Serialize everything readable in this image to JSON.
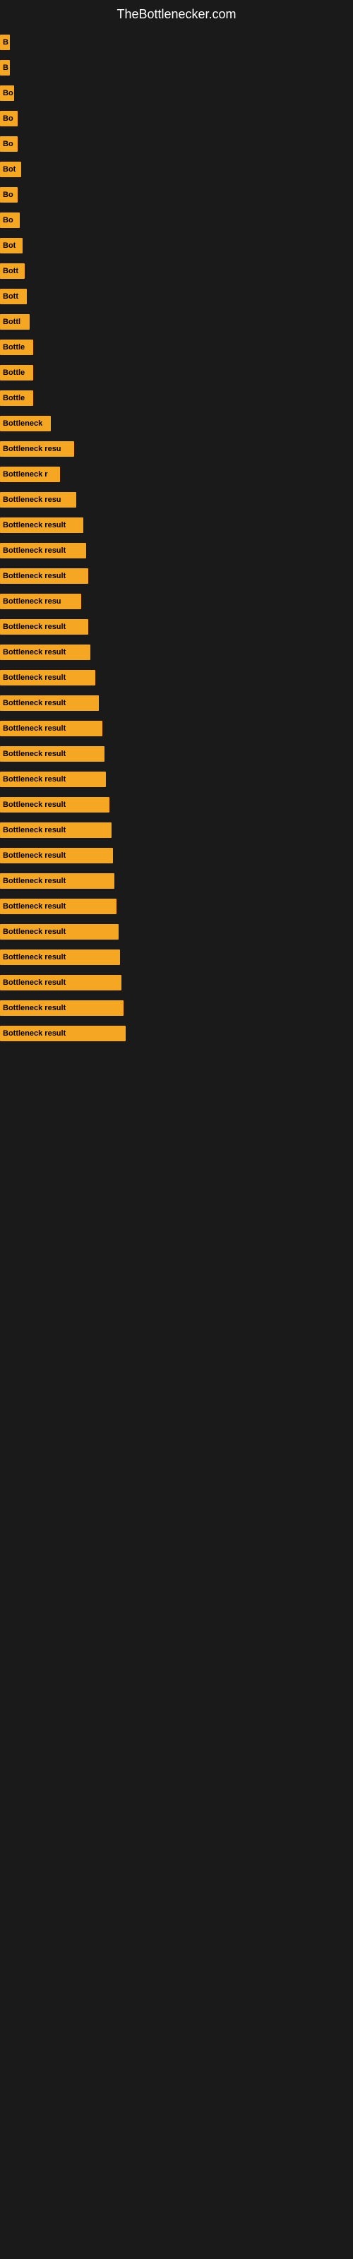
{
  "header": {
    "title": "TheBottlenecker.com"
  },
  "bars": [
    {
      "label": "B",
      "width": 14
    },
    {
      "label": "B",
      "width": 14
    },
    {
      "label": "Bo",
      "width": 20
    },
    {
      "label": "Bo",
      "width": 25
    },
    {
      "label": "Bo",
      "width": 25
    },
    {
      "label": "Bot",
      "width": 30
    },
    {
      "label": "Bo",
      "width": 25
    },
    {
      "label": "Bo",
      "width": 28
    },
    {
      "label": "Bot",
      "width": 32
    },
    {
      "label": "Bott",
      "width": 35
    },
    {
      "label": "Bott",
      "width": 38
    },
    {
      "label": "Bottl",
      "width": 42
    },
    {
      "label": "Bottle",
      "width": 47
    },
    {
      "label": "Bottle",
      "width": 47
    },
    {
      "label": "Bottle",
      "width": 47
    },
    {
      "label": "Bottleneck",
      "width": 72
    },
    {
      "label": "Bottleneck resu",
      "width": 105
    },
    {
      "label": "Bottleneck r",
      "width": 85
    },
    {
      "label": "Bottleneck resu",
      "width": 108
    },
    {
      "label": "Bottleneck result",
      "width": 118
    },
    {
      "label": "Bottleneck result",
      "width": 122
    },
    {
      "label": "Bottleneck result",
      "width": 125
    },
    {
      "label": "Bottleneck resu",
      "width": 115
    },
    {
      "label": "Bottleneck result",
      "width": 125
    },
    {
      "label": "Bottleneck result",
      "width": 128
    },
    {
      "label": "Bottleneck result",
      "width": 135
    },
    {
      "label": "Bottleneck result",
      "width": 140
    },
    {
      "label": "Bottleneck result",
      "width": 145
    },
    {
      "label": "Bottleneck result",
      "width": 148
    },
    {
      "label": "Bottleneck result",
      "width": 150
    },
    {
      "label": "Bottleneck result",
      "width": 155
    },
    {
      "label": "Bottleneck result",
      "width": 158
    },
    {
      "label": "Bottleneck result",
      "width": 160
    },
    {
      "label": "Bottleneck result",
      "width": 162
    },
    {
      "label": "Bottleneck result",
      "width": 165
    },
    {
      "label": "Bottleneck result",
      "width": 168
    },
    {
      "label": "Bottleneck result",
      "width": 170
    },
    {
      "label": "Bottleneck result",
      "width": 172
    },
    {
      "label": "Bottleneck result",
      "width": 175
    },
    {
      "label": "Bottleneck result",
      "width": 178
    }
  ]
}
